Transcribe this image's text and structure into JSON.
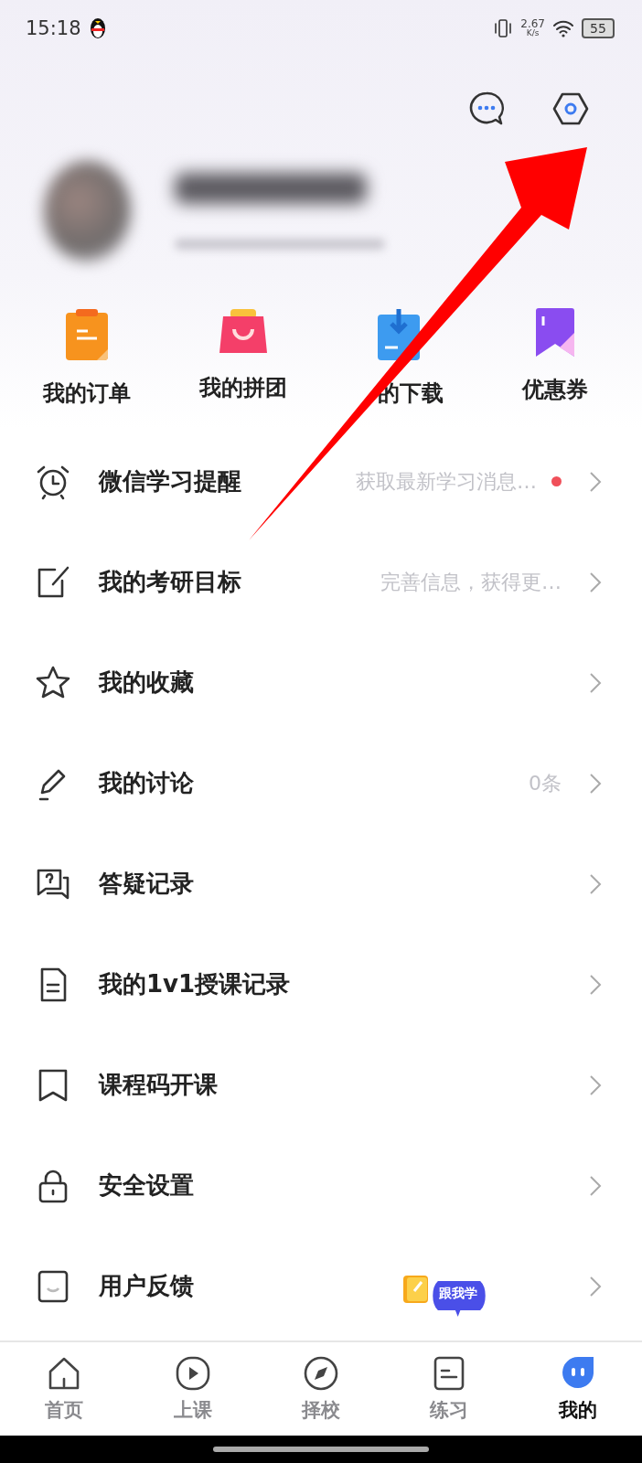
{
  "status_bar": {
    "time": "15:18",
    "speed_value": "2.67",
    "speed_unit": "K/s",
    "battery": "55"
  },
  "shortcuts": [
    {
      "kind": "order",
      "label": "我的订单"
    },
    {
      "kind": "group",
      "label": "我的拼团"
    },
    {
      "kind": "download",
      "label": "的下载"
    },
    {
      "kind": "coupon",
      "label": "优惠券"
    }
  ],
  "menu": [
    {
      "kind": "alarm",
      "label": "微信学习提醒",
      "hint": "获取最新学习消息…",
      "dot": true
    },
    {
      "kind": "edit",
      "label": "我的考研目标",
      "hint": "完善信息，获得更…",
      "dot": false
    },
    {
      "kind": "star",
      "label": "我的收藏",
      "dot": false
    },
    {
      "kind": "pen",
      "label": "我的讨论",
      "count": "0条",
      "dot": false
    },
    {
      "kind": "qa",
      "label": "答疑记录",
      "dot": false
    },
    {
      "kind": "doc",
      "label": "我的1v1授课记录",
      "dot": false
    },
    {
      "kind": "bookmark",
      "label": "课程码开课",
      "dot": false
    },
    {
      "kind": "lock",
      "label": "安全设置",
      "dot": false
    },
    {
      "kind": "feedback",
      "label": "用户反馈",
      "dot": false
    }
  ],
  "follow_bubble": {
    "label": "跟我学"
  },
  "tabs": [
    {
      "kind": "home",
      "label": "首页",
      "selected": false
    },
    {
      "kind": "play",
      "label": "上课",
      "selected": false
    },
    {
      "kind": "compass",
      "label": "择校",
      "selected": false
    },
    {
      "kind": "practice",
      "label": "练习",
      "selected": false
    },
    {
      "kind": "me",
      "label": "我的",
      "selected": true
    }
  ]
}
